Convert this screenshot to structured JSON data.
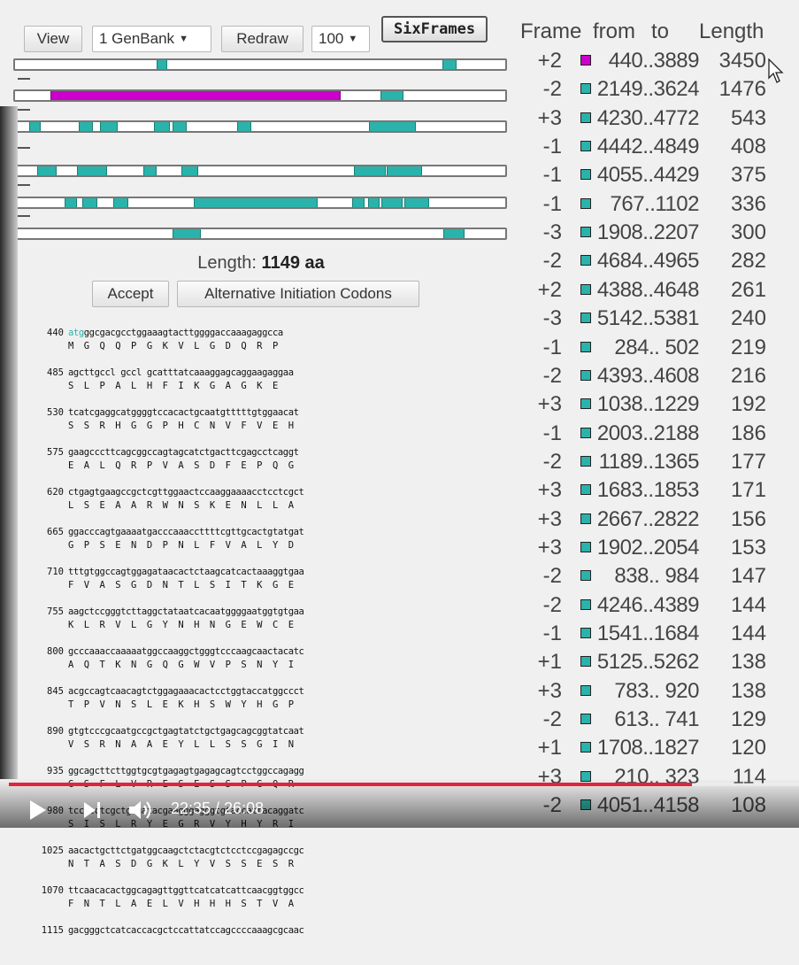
{
  "toolbar": {
    "view_label": "View",
    "genetic_code_value": "1 GenBank",
    "redraw_label": "Redraw",
    "min_length_value": "100",
    "sixframes_label": "SixFrames"
  },
  "table_header": {
    "frame": "Frame",
    "from": "from",
    "to": "to",
    "length": "Length"
  },
  "orfs": [
    {
      "frame": "+2",
      "range": "440..3889",
      "length": "3450",
      "color": "#cc00cc"
    },
    {
      "frame": "-2",
      "range": "2149..3624",
      "length": "1476",
      "color": "#2ab3aa"
    },
    {
      "frame": "+3",
      "range": "4230..4772",
      "length": "543",
      "color": "#2ab3aa"
    },
    {
      "frame": "-1",
      "range": "4442..4849",
      "length": "408",
      "color": "#2ab3aa"
    },
    {
      "frame": "-1",
      "range": "4055..4429",
      "length": "375",
      "color": "#2ab3aa"
    },
    {
      "frame": "-1",
      "range": "767..1102",
      "length": "336",
      "color": "#2ab3aa"
    },
    {
      "frame": "-3",
      "range": "1908..2207",
      "length": "300",
      "color": "#2ab3aa"
    },
    {
      "frame": "-2",
      "range": "4684..4965",
      "length": "282",
      "color": "#2ab3aa"
    },
    {
      "frame": "+2",
      "range": "4388..4648",
      "length": "261",
      "color": "#2ab3aa"
    },
    {
      "frame": "-3",
      "range": "5142..5381",
      "length": "240",
      "color": "#2ab3aa"
    },
    {
      "frame": "-1",
      "range": "284.. 502",
      "length": "219",
      "color": "#2ab3aa"
    },
    {
      "frame": "-2",
      "range": "4393..4608",
      "length": "216",
      "color": "#2ab3aa"
    },
    {
      "frame": "+3",
      "range": "1038..1229",
      "length": "192",
      "color": "#2ab3aa"
    },
    {
      "frame": "-1",
      "range": "2003..2188",
      "length": "186",
      "color": "#2ab3aa"
    },
    {
      "frame": "-2",
      "range": "1189..1365",
      "length": "177",
      "color": "#2ab3aa"
    },
    {
      "frame": "+3",
      "range": "1683..1853",
      "length": "171",
      "color": "#2ab3aa"
    },
    {
      "frame": "+3",
      "range": "2667..2822",
      "length": "156",
      "color": "#2ab3aa"
    },
    {
      "frame": "+3",
      "range": "1902..2054",
      "length": "153",
      "color": "#2ab3aa"
    },
    {
      "frame": "-2",
      "range": "838.. 984",
      "length": "147",
      "color": "#2ab3aa"
    },
    {
      "frame": "-2",
      "range": "4246..4389",
      "length": "144",
      "color": "#2ab3aa"
    },
    {
      "frame": "-1",
      "range": "1541..1684",
      "length": "144",
      "color": "#2ab3aa"
    },
    {
      "frame": "+1",
      "range": "5125..5262",
      "length": "138",
      "color": "#2ab3aa"
    },
    {
      "frame": "+3",
      "range": "783.. 920",
      "length": "138",
      "color": "#2ab3aa"
    },
    {
      "frame": "-2",
      "range": "613.. 741",
      "length": "129",
      "color": "#2ab3aa"
    },
    {
      "frame": "+1",
      "range": "1708..1827",
      "length": "120",
      "color": "#2ab3aa"
    },
    {
      "frame": "+3",
      "range": "210.. 323",
      "length": "114",
      "color": "#2ab3aa"
    },
    {
      "frame": "-2",
      "range": "4051..4158",
      "length": "108",
      "color": "#2ab3aa"
    }
  ],
  "selected_orf": {
    "length_prefix": "Length:",
    "length_value": "1149 aa",
    "accept_label": "Accept",
    "alt_codons_label": "Alternative Initiation Codons"
  },
  "sequence_rows": [
    {
      "pos": "440",
      "start": "atg",
      "nt": "ggcgacgcctggaaagtacttggggaccaaagaggcca",
      "aa": "M  G  Q  Q  P  G  K  V  L  G  D  Q  R  P"
    },
    {
      "pos": "485",
      "start": "",
      "nt": "agcttgccl gccl gcatttatcaaaggagcaggaagaggaa",
      "aa": "S  L  P  A  L  H  F  I  K  G  A  G  K  E"
    },
    {
      "pos": "530",
      "start": "",
      "nt": "tcatcgaggcatggggtccacactgcaatgtttttgtggaacat",
      "aa": "S  S  R  H  G  G  P  H  C  N  V  F  V  E  H"
    },
    {
      "pos": "575",
      "start": "",
      "nt": "gaagcccttcagcggccagtagcatctgacttcgagcctcaggt",
      "aa": "E  A  L  Q  R  P  V  A  S  D  F  E  P  Q  G"
    },
    {
      "pos": "620",
      "start": "",
      "nt": "ctgagtgaagccgctcgttggaactccaaggaaaacctcctcgct",
      "aa": "L  S  E  A  A  R  W  N  S  K  E  N  L  L  A"
    },
    {
      "pos": "665",
      "start": "",
      "nt": "ggacccagtgaaaatgacccaaaccttttcgttgcactgtatgat",
      "aa": "G  P  S  E  N  D  P  N  L  F  V  A  L  Y  D"
    },
    {
      "pos": "710",
      "start": "",
      "nt": "tttgtggccagtggagataacactctaagcatcactaaaggtgaa",
      "aa": "F  V  A  S  G  D  N  T  L  S  I  T  K  G  E"
    },
    {
      "pos": "755",
      "start": "",
      "nt": "aagctccgggtcttaggctataatcacaatggggaatggtgtgaa",
      "aa": "K  L  R  V  L  G  Y  N  H  N  G  E  W  C  E"
    },
    {
      "pos": "800",
      "start": "",
      "nt": "gcccaaaccaaaaatggccaaggctgggtcccaagcaactacatc",
      "aa": "A  Q  T  K  N  G  Q  G  W  V  P  S  N  Y  I"
    },
    {
      "pos": "845",
      "start": "",
      "nt": "acgccagtcaacagtctggagaaacactcctggtaccatggccct",
      "aa": "T  P  V  N  S  L  E  K  H  S  W  Y  H  G  P"
    },
    {
      "pos": "890",
      "start": "",
      "nt": "gtgtcccgcaatgccgctgagtatctgctgagcagcggtatcaat",
      "aa": "V  S  R  N  A  A  E  Y  L  L  S  S  G  I  N"
    },
    {
      "pos": "935",
      "start": "",
      "nt": "ggcagcttcttggtgcgtgagagtgagagcagtcctggccagagg",
      "aa": "G  S  F  L  V  R  E  S  E  S  S  P  G  Q  R"
    },
    {
      "pos": "980",
      "start": "",
      "nt": "tccatctcgctgagatacgaagggagggtgtaccattacaggatc",
      "aa": "S  I  S  L  R  Y  E  G  R  V  Y  H  Y  R  I"
    },
    {
      "pos": "1025",
      "start": "",
      "nt": "aacactgcttctgatggcaagctctacgtctcctccgagagccgc",
      "aa": "N  T  A  S  D  G  K  L  Y  V  S  S  E  S  R"
    },
    {
      "pos": "1070",
      "start": "",
      "nt": "ttcaacacactggcagagttggttcatcatcattcaacggtggcc",
      "aa": "F  N  T  L  A  E  L  V  H  H  H  S  T  V  A"
    },
    {
      "pos": "1115",
      "start": "",
      "nt": "gacgggctcatcaccacgctccattatccagccccaaagcgcaac",
      "aa": ""
    }
  ],
  "video": {
    "time": "22:35 / 26:08",
    "progress": 0.864
  }
}
